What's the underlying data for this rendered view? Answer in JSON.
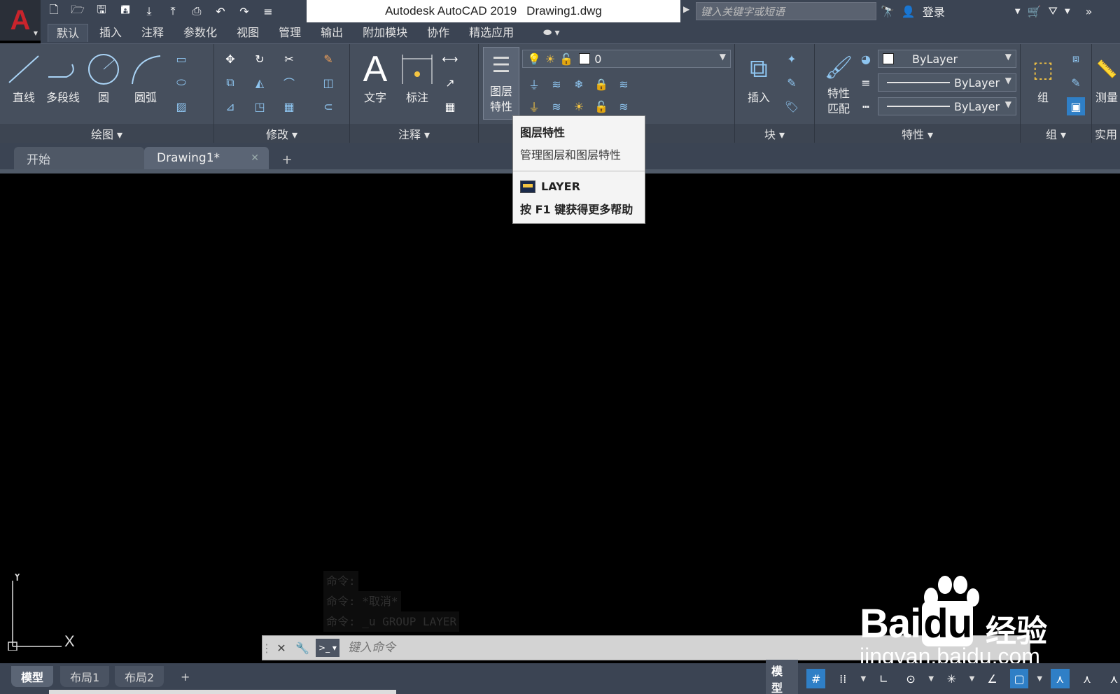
{
  "app": {
    "window_title": "Autodesk AutoCAD 2019",
    "file_name": "Drawing1.dwg",
    "logo_letter": "A"
  },
  "search": {
    "placeholder": "键入关键字或短语"
  },
  "signin": "登录",
  "ribbon_tabs": [
    "默认",
    "插入",
    "注释",
    "参数化",
    "视图",
    "管理",
    "输出",
    "附加模块",
    "协作",
    "精选应用"
  ],
  "panels": {
    "draw": {
      "title": "绘图 ▾",
      "line": "直线",
      "polyline": "多段线",
      "circle": "圆",
      "arc": "圆弧"
    },
    "modify": {
      "title": "修改 ▾"
    },
    "annotation": {
      "title": "注释 ▾",
      "text": "文字",
      "dimension": "标注"
    },
    "layers": {
      "layer_props_line1": "图层",
      "layer_props_line2": "特性",
      "current_layer": "0"
    },
    "block": {
      "title": "块 ▾",
      "insert": "插入"
    },
    "properties": {
      "title": "特性 ▾",
      "match_line1": "特性",
      "match_line2": "匹配",
      "color": "ByLayer",
      "lineweight": "ByLayer",
      "linetype": "ByLayer"
    },
    "groups": {
      "title": "组 ▾",
      "group": "组"
    },
    "utilities": {
      "title": "实用",
      "measure": "测量"
    }
  },
  "doc_tabs": {
    "start": "开始",
    "current": "Drawing1*"
  },
  "tooltip": {
    "title": "图层特性",
    "description": "管理图层和图层特性",
    "command": "LAYER",
    "help": "按 F1 键获得更多帮助"
  },
  "command_history": [
    "命令:",
    "命令: *取消*",
    "命令: _u GROUP LAYER"
  ],
  "command_line": {
    "placeholder": "键入命令"
  },
  "ucs": {
    "y": "Y",
    "x": "X"
  },
  "watermark": {
    "brand": "Bai",
    "brand2": "du",
    "cn": "经验",
    "url": "jingyan.baidu.com"
  },
  "layout_tabs": [
    "模型",
    "布局1",
    "布局2"
  ],
  "status": {
    "model": "模型"
  }
}
